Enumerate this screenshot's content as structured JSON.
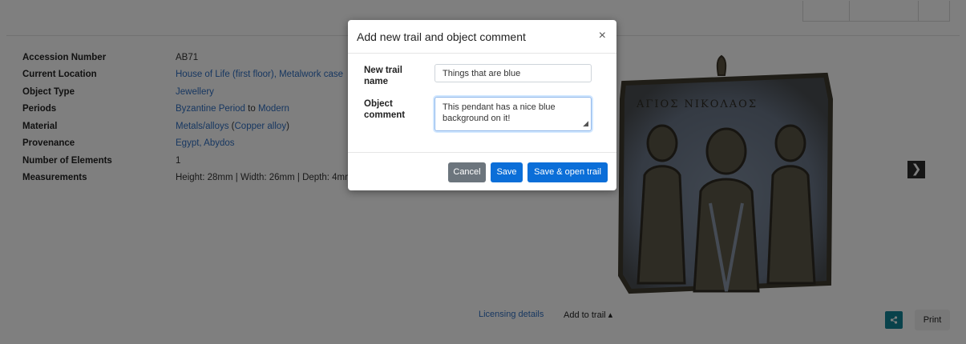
{
  "details": [
    {
      "label": "Accession Number",
      "parts": [
        {
          "text": "AB71",
          "link": false
        }
      ]
    },
    {
      "label": "Current Location",
      "parts": [
        {
          "text": "House of Life (first floor), Metalwork case",
          "link": true
        }
      ]
    },
    {
      "label": "Object Type",
      "parts": [
        {
          "text": "Jewellery",
          "link": true
        }
      ]
    },
    {
      "label": "Periods",
      "parts": [
        {
          "text": "Byzantine Period",
          "link": true
        },
        {
          "text": " to ",
          "link": false
        },
        {
          "text": "Modern",
          "link": true
        }
      ]
    },
    {
      "label": "Material",
      "parts": [
        {
          "text": "Metals/alloys",
          "link": true
        },
        {
          "text": " (",
          "link": false
        },
        {
          "text": "Copper alloy",
          "link": true
        },
        {
          "text": ")",
          "link": false
        }
      ]
    },
    {
      "label": "Provenance",
      "parts": [
        {
          "text": "Egypt, Abydos",
          "link": true
        }
      ]
    },
    {
      "label": "Number of Elements",
      "parts": [
        {
          "text": "1",
          "link": false
        }
      ]
    },
    {
      "label": "Measurements",
      "parts": [
        {
          "text": "Height: 28mm | Width: 26mm | Depth: 4mm",
          "link": false
        }
      ]
    }
  ],
  "artifact": {
    "inscription": "ΑΓΙΟΣ ΝΙΚΟΛΑΟΣ"
  },
  "footer": {
    "licensing_label": "Licensing details",
    "add_to_trail_label": "Add to trail ▴",
    "share_icon": "share-icon",
    "print_label": "Print"
  },
  "modal": {
    "title": "Add new trail and object comment",
    "close_label": "×",
    "trail_name_label": "New trail name",
    "trail_name_value": "Things that are blue",
    "comment_label": "Object comment",
    "comment_value": "This pendant has a nice blue background on it!",
    "cancel_label": "Cancel",
    "save_label": "Save",
    "save_open_label": "Save & open trail"
  },
  "colors": {
    "link": "#2f6fc2",
    "primary": "#0b6ed8",
    "secondary": "#6c757d",
    "share": "#138496"
  }
}
